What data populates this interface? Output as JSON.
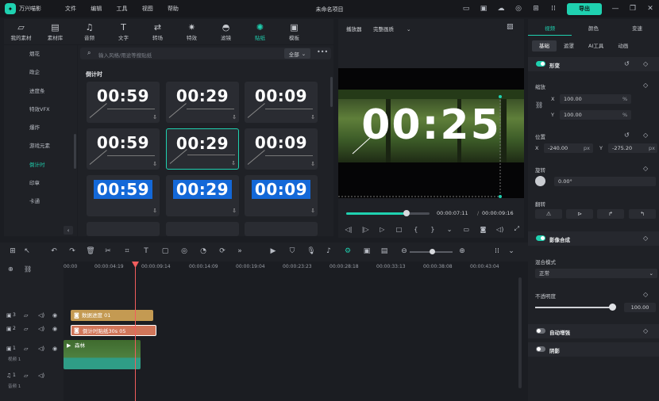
{
  "app": {
    "name": "万兴喵影",
    "project_title": "未命名项目",
    "export_label": "导出"
  },
  "menu": [
    "文件",
    "编辑",
    "工具",
    "视图",
    "帮助"
  ],
  "toolbar": [
    {
      "label": "我的素材",
      "icon": "folder-icon"
    },
    {
      "label": "素材库",
      "icon": "library-icon"
    },
    {
      "label": "音频",
      "icon": "music-icon"
    },
    {
      "label": "文字",
      "icon": "text-icon"
    },
    {
      "label": "转场",
      "icon": "transition-icon"
    },
    {
      "label": "特效",
      "icon": "effects-icon"
    },
    {
      "label": "滤镜",
      "icon": "filter-icon"
    },
    {
      "label": "贴纸",
      "icon": "sticker-icon"
    },
    {
      "label": "模板",
      "icon": "template-icon"
    }
  ],
  "sidebar": [
    "烟花",
    "政企",
    "进度条",
    "特效VFX",
    "爆炸",
    "游戏元素",
    "倒计时",
    "印章",
    "卡通"
  ],
  "search": {
    "placeholder": "输入风格/用途等搜贴纸",
    "filter": "全部"
  },
  "section": {
    "title": "倒计时"
  },
  "stickers": [
    "00:59",
    "00:29",
    "00:09",
    "00:59",
    "00:29",
    "00:09",
    "00:59",
    "00:29",
    "00:09"
  ],
  "player": {
    "label": "播放器",
    "quality": "完整画质",
    "overlay_time": "00:25",
    "current_time": "00:00:07:11",
    "total_time": "00:00:09:16",
    "progress": 0.72
  },
  "right": {
    "tabs": [
      "视频",
      "颜色",
      "变速"
    ],
    "subtabs": [
      "基础",
      "遮罩",
      "AI工具",
      "动画"
    ],
    "transform": "形变",
    "scale": "缩放",
    "scale_x": "100.00",
    "scale_y": "100.00",
    "pct": "%",
    "position": "位置",
    "pos_x": "-240.00",
    "pos_y": "-275.20",
    "px": "px",
    "rotate": "旋转",
    "rotate_val": "0.00°",
    "flip": "翻转",
    "composite": "影像合成",
    "blend": "混合模式",
    "blend_val": "正常",
    "opacity": "不透明度",
    "opacity_val": "100.00",
    "auto_enhance": "自动增强",
    "shadow": "阴影",
    "x": "X",
    "y": "Y"
  },
  "timeline": {
    "ticks": [
      "00:00",
      "00:00:04:19",
      "00:00:09:14",
      "00:00:14:09",
      "00:00:19:04",
      "00:00:23:23",
      "00:00:28:18",
      "00:00:33:13",
      "00:00:38:08",
      "00:00:43:04"
    ],
    "tracks": [
      {
        "num": "3"
      },
      {
        "num": "2"
      },
      {
        "num": "1",
        "name": "视频 1"
      },
      {
        "num": "1",
        "name": "音频 1"
      }
    ],
    "clips": {
      "c3": "数据进度 01",
      "c2": "倒计时贴纸30s 05",
      "c1": "森林"
    }
  },
  "colors": {
    "accent": "#1fd1b0",
    "playhead": "#f25d5d"
  }
}
